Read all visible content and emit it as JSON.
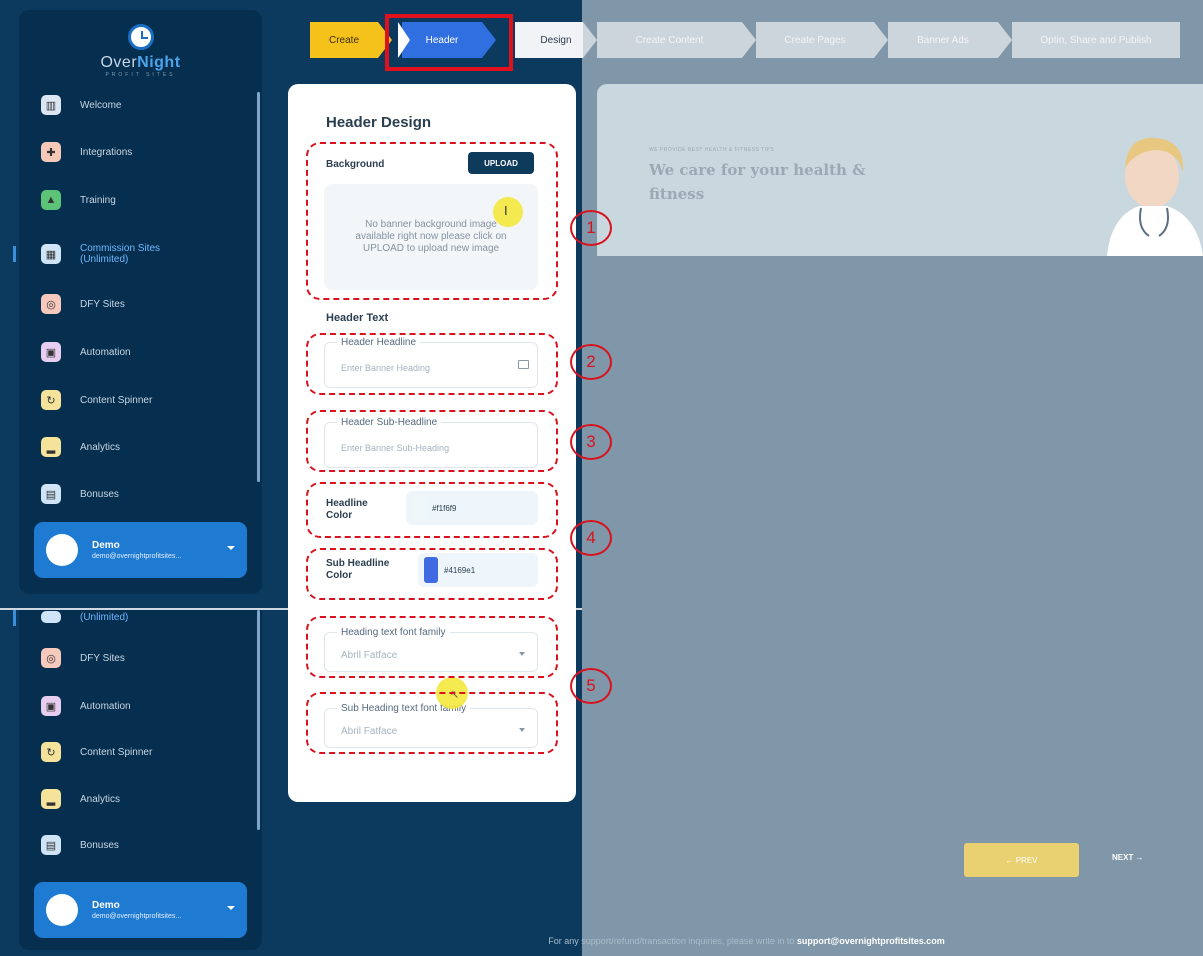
{
  "brand": {
    "name_part1": "Over",
    "name_part2": "Night",
    "tagline": "PROFIT SITES"
  },
  "sidebar": {
    "items": [
      {
        "label": "Welcome",
        "icon": "building-icon",
        "color": "#dce6f3"
      },
      {
        "label": "Integrations",
        "icon": "puzzle-icon",
        "color": "#f6c8b8"
      },
      {
        "label": "Training",
        "icon": "graduation-icon",
        "color": "#5cc377"
      },
      {
        "label": "Commission Sites (Unlimited)",
        "icon": "sites-icon",
        "color": "#cfe5f7"
      },
      {
        "label": "DFY Sites",
        "icon": "target-icon",
        "color": "#f7c9bd"
      },
      {
        "label": "Automation",
        "icon": "robot-icon",
        "color": "#e7cdef"
      },
      {
        "label": "Content Spinner",
        "icon": "spinner-icon",
        "color": "#f5e39b"
      },
      {
        "label": "Analytics",
        "icon": "chart-icon",
        "color": "#f5e39b"
      },
      {
        "label": "Bonuses",
        "icon": "gift-icon",
        "color": "#cfe5f7"
      }
    ],
    "items_lower": [
      {
        "label": "(Unlimited)",
        "icon": "sites-icon",
        "color": "#cfe5f7"
      },
      {
        "label": "DFY Sites",
        "icon": "target-icon",
        "color": "#f7c9bd"
      },
      {
        "label": "Automation",
        "icon": "robot-icon",
        "color": "#e7cdef"
      },
      {
        "label": "Content Spinner",
        "icon": "spinner-icon",
        "color": "#f5e39b"
      },
      {
        "label": "Analytics",
        "icon": "chart-icon",
        "color": "#f5e39b"
      },
      {
        "label": "Bonuses",
        "icon": "gift-icon",
        "color": "#cfe5f7"
      }
    ],
    "user": {
      "name": "Demo",
      "email": "demo@overnightprofitsites..."
    }
  },
  "steps": [
    "Create",
    "Header",
    "Design",
    "Create Content",
    "Create Pages",
    "Banner Ads",
    "Optin, Share and Publish"
  ],
  "panel": {
    "title": "Header Design",
    "background_label": "Background",
    "upload_label": "UPLOAD",
    "no_image_text": "No banner background image available right now please click on UPLOAD to upload new image",
    "header_text_label": "Header Text",
    "headline_legend": "Header Headline",
    "headline_placeholder": "Enter Banner Heading",
    "subheadline_legend": "Header Sub-Headline",
    "subheadline_placeholder": "Enter Banner Sub-Heading",
    "headline_color_label": "Headline Color",
    "headline_color_value": "#f1f6f9",
    "sub_headline_color_label": "Sub Headline Color",
    "sub_headline_color_value": "#4169e1",
    "heading_font_legend": "Heading text font family",
    "heading_font_value": "Abril Fatface",
    "sub_heading_font_legend": "Sub Heading text font family",
    "sub_heading_font_value": "Abril Fatface"
  },
  "annotations": [
    "1",
    "2",
    "3",
    "4",
    "5"
  ],
  "preview": {
    "eyebrow": "WE PROVIDE BEST HEALTH & FITNESS TIPS",
    "headline": "We care for your health & fitness",
    "prev_label": "← PREV",
    "next_label": "NEXT →"
  },
  "footer": {
    "text": "For any support/refund/transaction inquiries, please write in to ",
    "email": "support@overnightprofitsites.com"
  },
  "colors": {
    "accent": "#1f7bd1",
    "step_active": "#2f6fe0",
    "step_create": "#f5c21b",
    "annotation": "#d8121e"
  }
}
